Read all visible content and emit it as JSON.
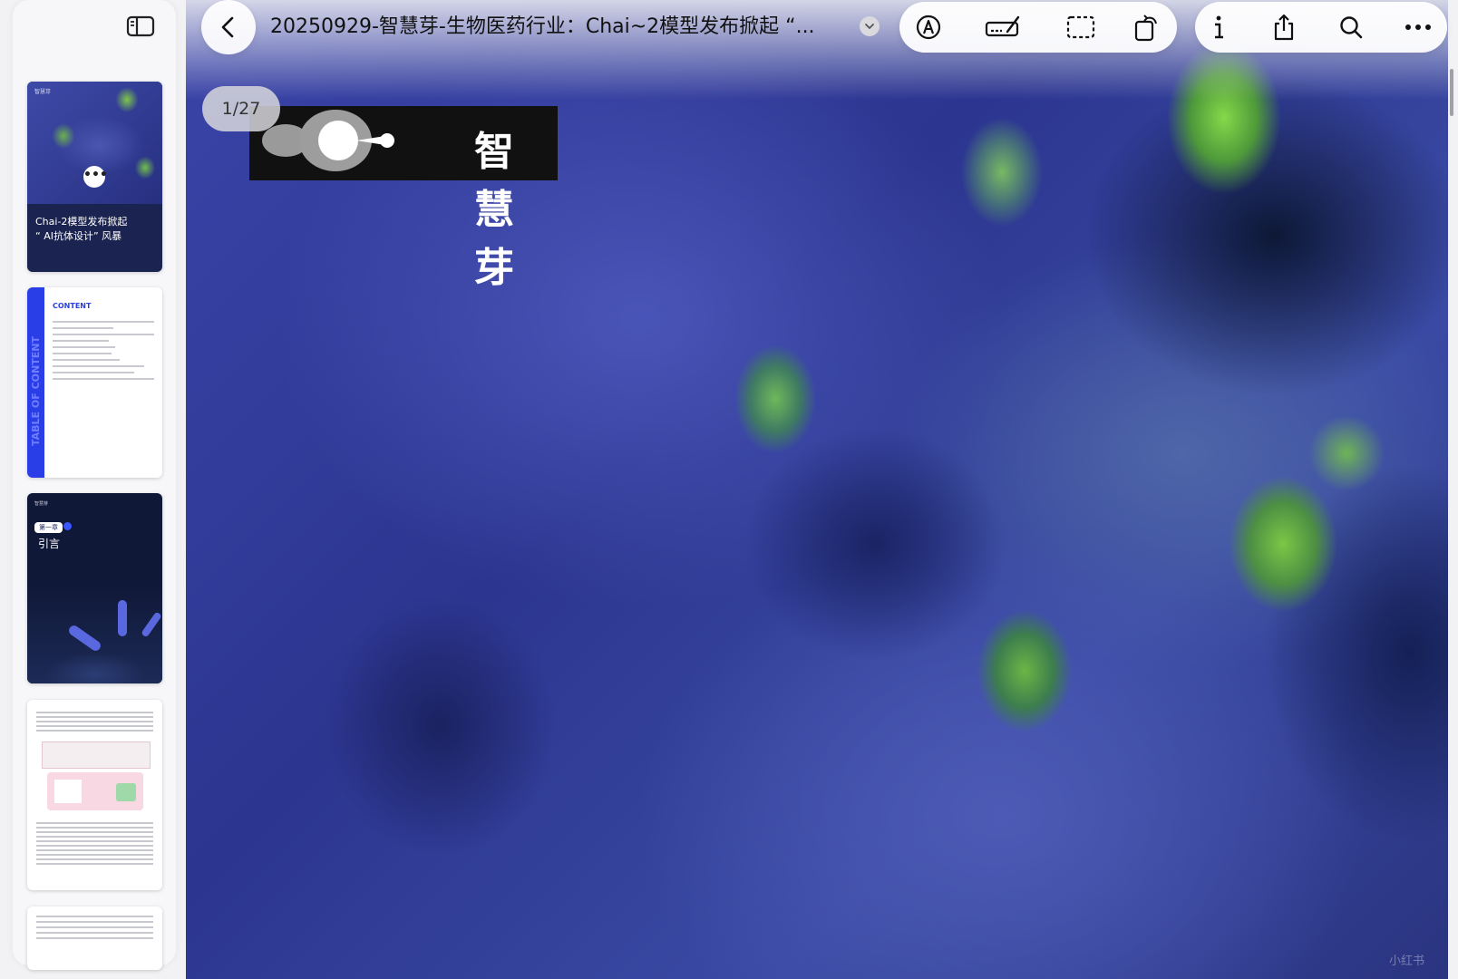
{
  "document": {
    "title": "20250929-智慧芽-生物医药行业：Chai~2模型发布掀起 “...",
    "page_indicator": "1/27",
    "brand_text": "智慧芽",
    "watermark": "小红书"
  },
  "toolbar": {
    "back_icon": "chevron-left-icon",
    "title_menu_icon": "chevron-down-icon",
    "markup_icon": "markup-pen-icon",
    "highlight_icon": "highlighter-icon",
    "select_icon": "selection-rectangle-icon",
    "rotate_icon": "rotate-icon",
    "info_icon": "info-icon",
    "share_icon": "share-icon",
    "search_icon": "search-icon",
    "more_icon": "ellipsis-icon"
  },
  "sidebar": {
    "toggle_icon": "sidebar-icon",
    "thumbnails": [
      {
        "title_line1": "Chai-2模型发布掀起",
        "title_line2": "“ AI抗体设计” 风暴",
        "more": "•••",
        "brand": "智慧芽"
      },
      {
        "heading": "CONTENT",
        "side_label": "TABLE OF CONTENT"
      },
      {
        "brand": "智慧芽",
        "chapter": "第一章",
        "name": "引言"
      },
      {},
      {}
    ]
  }
}
